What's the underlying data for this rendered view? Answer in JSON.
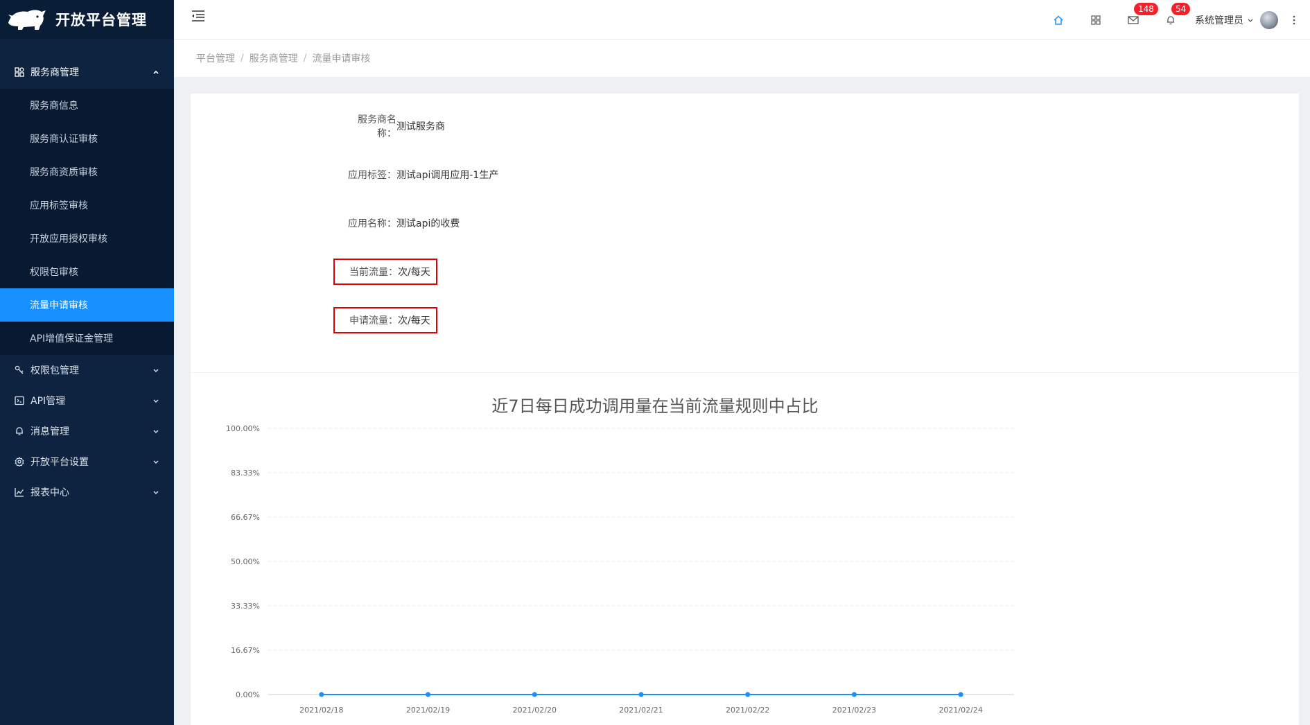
{
  "app": {
    "title": "开放平台管理"
  },
  "sidebar": {
    "groups": [
      {
        "label": "服务商管理",
        "icon": "apps-icon",
        "open": true,
        "items": [
          {
            "label": "服务商信息"
          },
          {
            "label": "服务商认证审核"
          },
          {
            "label": "服务商资质审核"
          },
          {
            "label": "应用标签审核"
          },
          {
            "label": "开放应用授权审核"
          },
          {
            "label": "权限包审核"
          },
          {
            "label": "流量申请审核",
            "active": true
          },
          {
            "label": "API增值保证金管理"
          }
        ]
      },
      {
        "label": "权限包管理",
        "icon": "key-icon"
      },
      {
        "label": "API管理",
        "icon": "api-icon"
      },
      {
        "label": "消息管理",
        "icon": "bell-icon"
      },
      {
        "label": "开放平台设置",
        "icon": "gear-icon"
      },
      {
        "label": "报表中心",
        "icon": "line-chart-icon"
      }
    ]
  },
  "header": {
    "mail_badge": "148",
    "bell_badge": "54",
    "user_name": "系统管理员",
    "accent": "#1890ff",
    "badge_color": "#f5222d"
  },
  "breadcrumb": [
    "平台管理",
    "服务商管理",
    "流量申请审核"
  ],
  "detail": {
    "rows": [
      {
        "label": "服务商名称：",
        "value": "测试服务商"
      },
      {
        "label": "应用标签：",
        "value": "测试api调用应用-1生产"
      },
      {
        "label": "应用名称：",
        "value": "测试api的收费"
      },
      {
        "label": "当前流量：",
        "value": "次/每天",
        "highlight": true
      },
      {
        "label": "申请流量：",
        "value": "次/每天",
        "highlight": true
      }
    ],
    "highlight_color": "#e30000"
  },
  "chart_data": {
    "type": "line",
    "title": "近7日每日成功调用量在当前流量规则中占比",
    "categories": [
      "2021/02/18",
      "2021/02/19",
      "2021/02/20",
      "2021/02/21",
      "2021/02/22",
      "2021/02/23",
      "2021/02/24"
    ],
    "series": [
      {
        "values": [
          0,
          0,
          0,
          0,
          0,
          0,
          0
        ]
      }
    ],
    "yticks": [
      "0.00%",
      "16.67%",
      "33.33%",
      "50.00%",
      "66.67%",
      "83.33%",
      "100.00%"
    ],
    "ylim": [
      0,
      100
    ],
    "grid": true,
    "line_color": "#1890ff"
  }
}
